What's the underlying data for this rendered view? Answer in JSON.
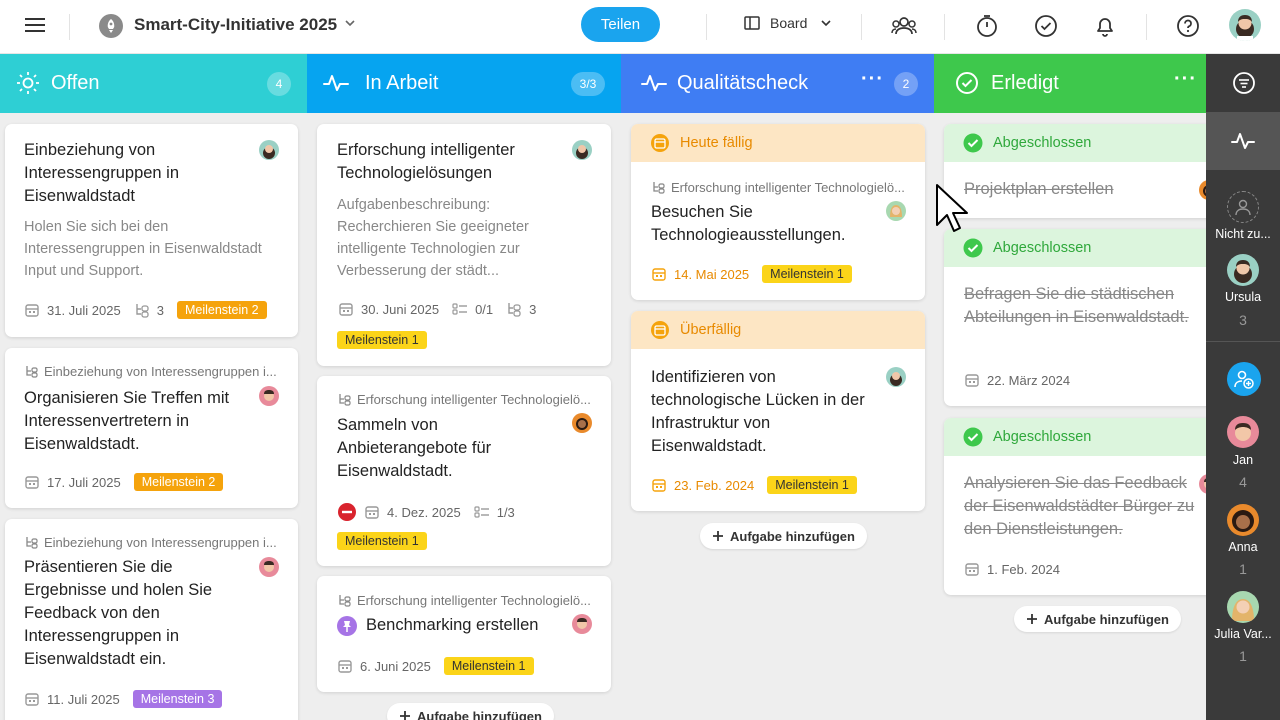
{
  "header": {
    "project_title": "Smart-City-Initiative 2025",
    "share_label": "Teilen",
    "view_label": "Board",
    "icons": [
      "menu-icon",
      "rocket-icon",
      "chevron-down-icon",
      "team-icon",
      "timer-icon",
      "check-circle-icon",
      "bell-icon",
      "help-icon",
      "user-avatar"
    ]
  },
  "colors": {
    "offen": "#2ecfd4",
    "in_arbeit": "#06a4f0",
    "qualitaet": "#3f7df3",
    "erledigt": "#3ec84c",
    "sidebar": "#3a3a3a",
    "share": "#1aa4ee"
  },
  "columns": {
    "offen": {
      "title": "Offen",
      "count": "4",
      "cards": [
        {
          "title": "Einbeziehung von Interessengruppen in Eisenwaldstadt",
          "desc": "Holen Sie sich bei den Interessengruppen in Eisenwaldstadt Input und Support.",
          "date": "31. Juli 2025",
          "subtasks": "3",
          "milestone": "Meilenstein 2"
        },
        {
          "parent": "Einbeziehung von Interessengruppen i...",
          "title": "Organisieren Sie Treffen mit Interessenvertretern in Eisenwaldstadt.",
          "date": "17. Juli 2025",
          "milestone": "Meilenstein 2"
        },
        {
          "parent": "Einbeziehung von Interessengruppen i...",
          "title": "Präsentieren Sie die Ergebnisse und holen Sie Feedback von den Interessengruppen in Eisenwaldstadt ein.",
          "date": "11. Juli 2025",
          "milestone": "Meilenstein 3"
        }
      ]
    },
    "in_arbeit": {
      "title": "In Arbeit",
      "count": "3/3",
      "cards": [
        {
          "title": "Erforschung intelligenter Technologielösungen",
          "desc_label": "Aufgabenbeschreibung:",
          "desc": "Recherchieren Sie geeigneter intelligente Technologien zur Verbesserung der städt...",
          "date": "30. Juni 2025",
          "checklist": "0/1",
          "subtasks": "3",
          "milestone": "Meilenstein 1"
        },
        {
          "parent": "Erforschung intelligenter Technologielö...",
          "title": "Sammeln von Anbieterangebote für Eisenwaldstadt.",
          "date": "4. Dez. 2025",
          "checklist": "1/3",
          "milestone": "Meilenstein 1"
        },
        {
          "parent": "Erforschung intelligenter Technologielö...",
          "title": "Benchmarking erstellen",
          "date": "6. Juni 2025",
          "milestone": "Meilenstein 1"
        }
      ],
      "add_label": "Aufgabe hinzufügen"
    },
    "qualitaet": {
      "title": "Qualitätscheck",
      "count": "2",
      "cards": [
        {
          "banner": "Heute fällig",
          "parent": "Erforschung intelligenter Technologielö...",
          "title": "Besuchen Sie Technologieausstellungen.",
          "date": "14. Mai 2025",
          "milestone": "Meilenstein 1"
        },
        {
          "banner": "Überfällig",
          "title": "Identifizieren von technologische Lücken in der Infrastruktur von Eisenwaldstadt.",
          "date": "23. Feb. 2024",
          "milestone": "Meilenstein 1"
        }
      ],
      "add_label": "Aufgabe hinzufügen"
    },
    "erledigt": {
      "title": "Erledigt",
      "cards": [
        {
          "banner": "Abgeschlossen",
          "title": "Projektplan erstellen"
        },
        {
          "banner": "Abgeschlossen",
          "title": "Befragen Sie die städtischen Abteilungen in Eisenwaldstadt.",
          "date": "22. März 2024"
        },
        {
          "banner": "Abgeschlossen",
          "title": "Analysieren Sie das Feedback der Eisenwaldstädter Bürger zu den Dienstleistungen.",
          "date": "1. Feb. 2024"
        }
      ],
      "add_label": "Aufgabe hinzufügen"
    }
  },
  "sidebar": {
    "users": [
      {
        "name": "Nicht zu...",
        "count": ""
      },
      {
        "name": "Ursula",
        "count": "3"
      },
      {
        "name": "Jan",
        "count": "4"
      },
      {
        "name": "Anna",
        "count": "1"
      },
      {
        "name": "Julia Var...",
        "count": "1"
      }
    ]
  }
}
